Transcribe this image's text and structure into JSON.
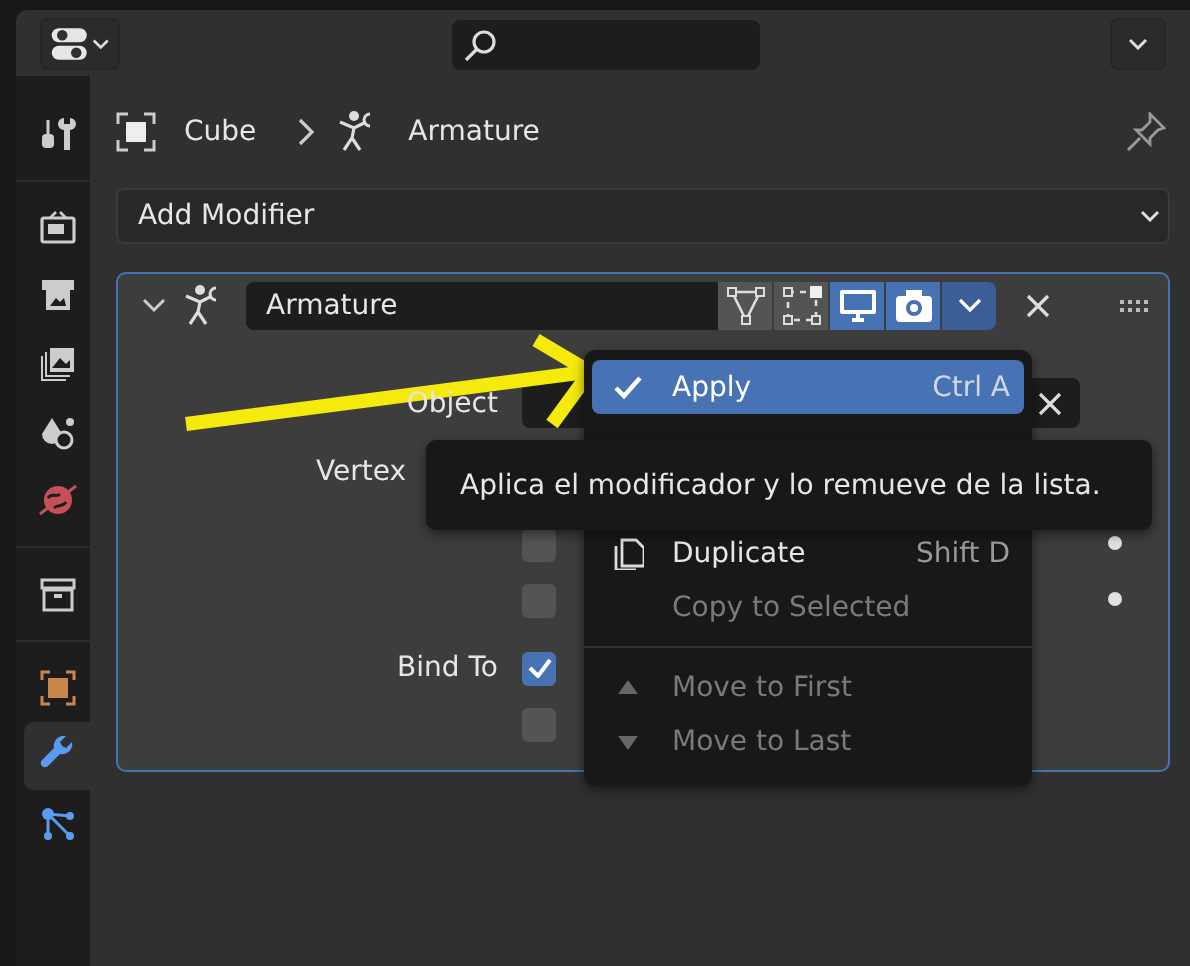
{
  "sidebar": {
    "tabs": [
      {
        "selected": false
      },
      {
        "selected": false
      },
      {
        "selected": false
      },
      {
        "selected": false
      },
      {
        "selected": false
      },
      {
        "selected": false
      },
      {
        "selected": false
      },
      {
        "selected": false
      },
      {
        "selected": true
      },
      {
        "selected": false
      }
    ]
  },
  "breadcrumb": [
    "Cube",
    "Armature"
  ],
  "add_modifier": {
    "label": "Add Modifier"
  },
  "modifier": {
    "name": "Armature",
    "toggles": [
      {
        "on": false
      },
      {
        "on": false
      },
      {
        "on": true
      },
      {
        "on": true
      }
    ],
    "rows": [
      {
        "kind": "field",
        "label": "Object"
      },
      {
        "kind": "label",
        "label": "Vertex"
      },
      {
        "kind": "check",
        "label": "",
        "checked": false
      },
      {
        "kind": "check",
        "label": "",
        "checked": false
      },
      {
        "kind": "check",
        "label": "Bind To",
        "checked": true
      },
      {
        "kind": "check",
        "label": "",
        "checked": false
      }
    ]
  },
  "menu": {
    "items": [
      {
        "kind": "item",
        "label": "Apply",
        "shortcut": "Ctrl A",
        "selected": true,
        "disabled": false
      },
      {
        "kind": "hidden"
      },
      {
        "kind": "hidden"
      },
      {
        "kind": "item",
        "label": "Duplicate",
        "shortcut": "Shift D",
        "selected": false,
        "disabled": false
      },
      {
        "kind": "item",
        "label": "Copy to Selected",
        "selected": false,
        "disabled": true
      },
      {
        "kind": "separator"
      },
      {
        "kind": "item",
        "label": "Move to First",
        "selected": false,
        "disabled": true
      },
      {
        "kind": "item",
        "label": "Move to Last",
        "selected": false,
        "disabled": true
      }
    ]
  },
  "tooltip": {
    "text": "Aplica el modificador y lo remueve de la lista."
  }
}
